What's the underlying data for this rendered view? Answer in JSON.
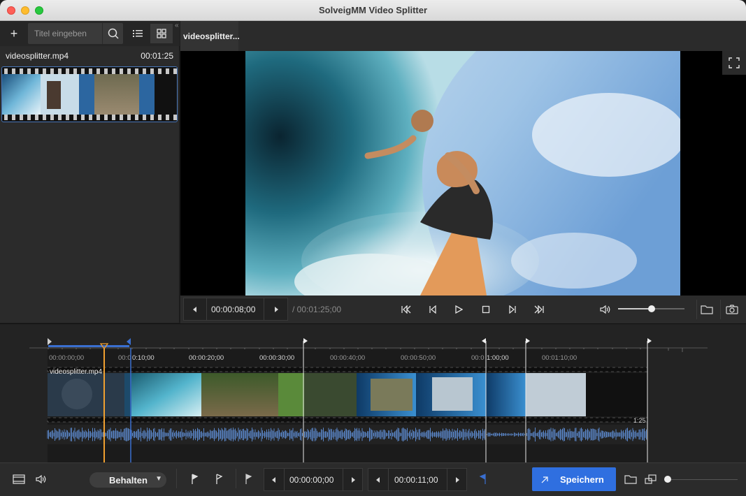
{
  "window": {
    "title": "SolveigMM Video Splitter"
  },
  "library": {
    "add_label": "+",
    "search_placeholder": "Titel eingeben",
    "file": {
      "name": "videosplitter.mp4",
      "duration": "00:01:25"
    }
  },
  "tabs": [
    {
      "label": "videosplitter..."
    }
  ],
  "player": {
    "current_time": "00:00:08;00",
    "total_time": "/ 00:01:25;00",
    "volume_level": 0.5
  },
  "timeline": {
    "ticks": [
      "00:00:00;00",
      "00:0",
      "0:10;00",
      "00:00:20;00",
      "00:00:30;00",
      "00:00:40;00",
      "00:00:50;00",
      "00:0",
      "1:00;00",
      "00:01:10;00"
    ],
    "clip_name": "videosplitter.mp4",
    "end_label": "1:25"
  },
  "bottombar": {
    "mode": "Behalten",
    "mark_in_time": "00:00:00;00",
    "mark_out_time": "00:00:11;00",
    "save_label": "Speichern"
  },
  "colors": {
    "accent": "#2f6fe0",
    "playhead": "#f0a030",
    "waveform": "#5a86c8"
  }
}
